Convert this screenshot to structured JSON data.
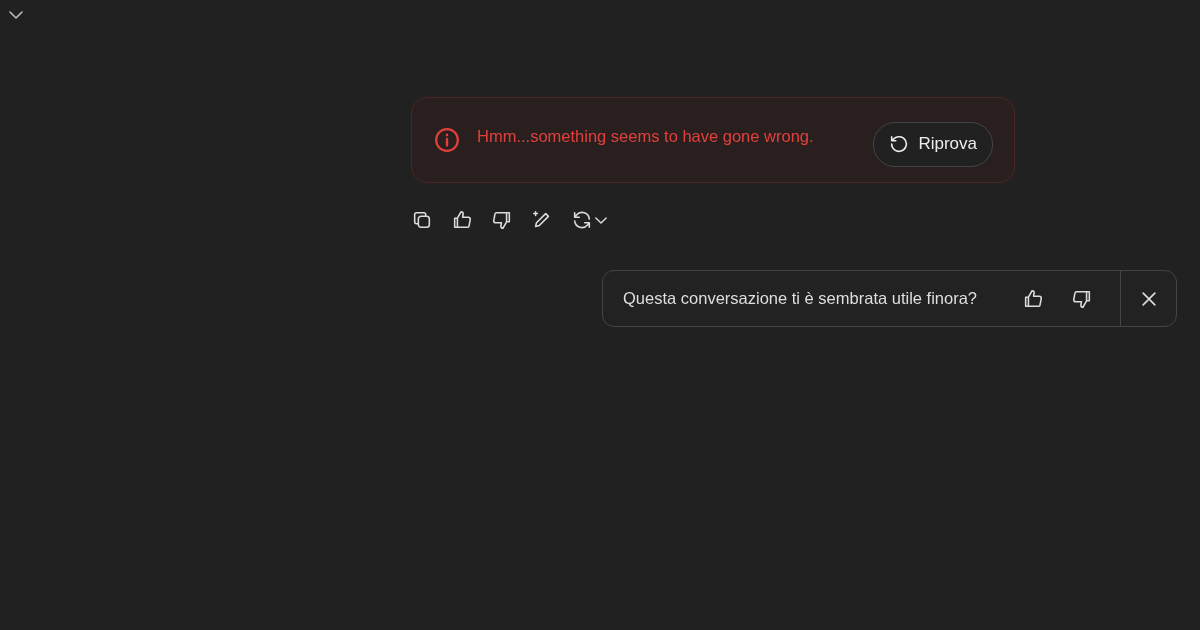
{
  "error": {
    "message": "Hmm...something seems to have gone wrong.",
    "retry_label": "Riprova"
  },
  "actions": [
    {
      "kind": "copy"
    },
    {
      "kind": "like"
    },
    {
      "kind": "dislike"
    },
    {
      "kind": "edit"
    },
    {
      "kind": "regenerate"
    }
  ],
  "feedback": {
    "question": "Questa conversazione ti è sembrata utile finora?"
  }
}
